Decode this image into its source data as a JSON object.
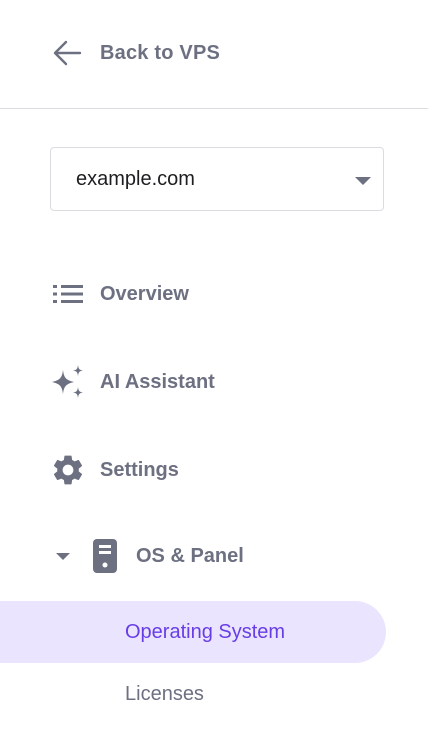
{
  "back_link": {
    "label": "Back to VPS",
    "icon": "arrow-left-icon"
  },
  "domain_select": {
    "value": "example.com",
    "icon": "caret-down-icon"
  },
  "nav": {
    "items": [
      {
        "label": "Overview",
        "icon": "list-icon"
      },
      {
        "label": "AI Assistant",
        "icon": "sparkles-icon"
      },
      {
        "label": "Settings",
        "icon": "gear-icon"
      }
    ],
    "os_panel": {
      "label": "OS & Panel",
      "icon": "server-icon",
      "expanded": true,
      "children": [
        {
          "label": "Operating System",
          "active": true
        },
        {
          "label": "Licenses",
          "active": false
        }
      ]
    }
  },
  "colors": {
    "text_muted": "#6d7081",
    "accent": "#673de6",
    "active_bg": "#ebe4ff",
    "divider": "#dadce0"
  }
}
